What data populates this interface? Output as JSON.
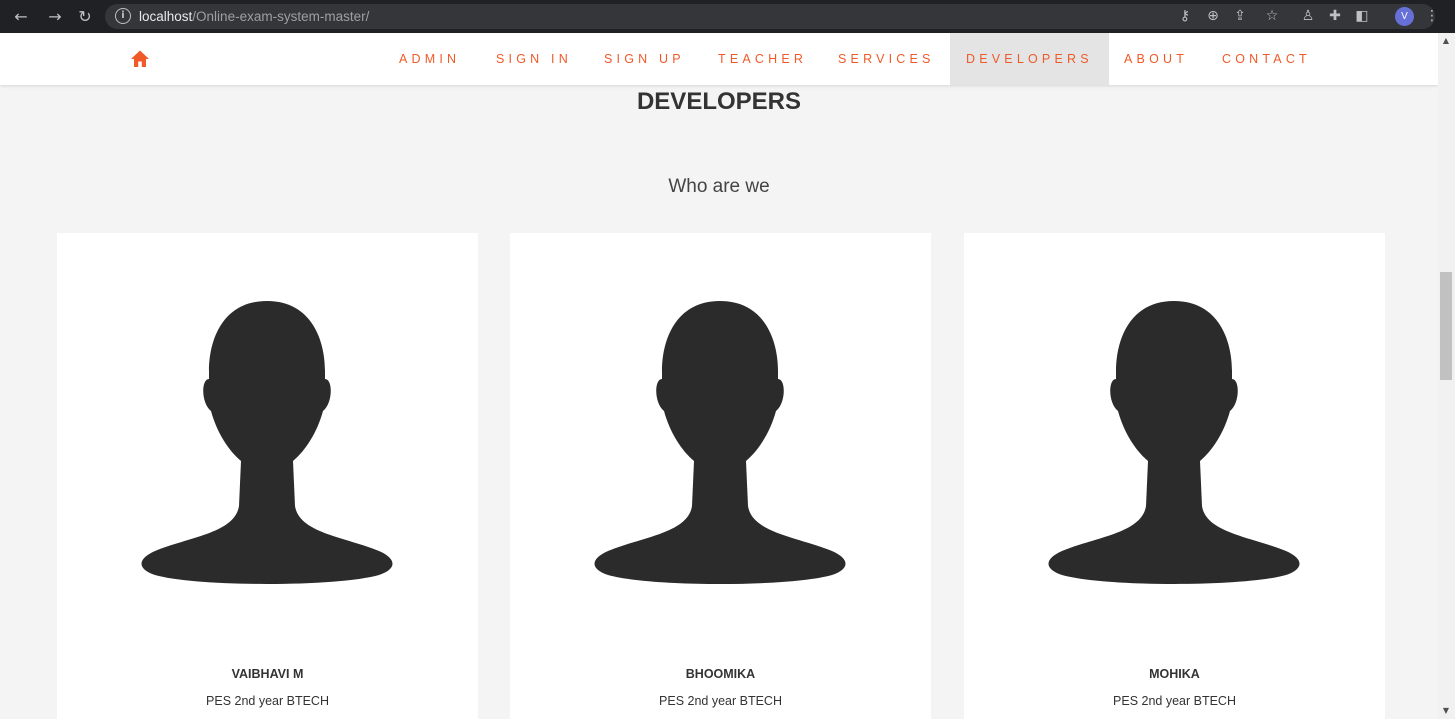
{
  "browser": {
    "url_host": "localhost",
    "url_path": "/Online-exam-system-master/",
    "profile_initial": "V",
    "icons": [
      "back-icon",
      "forward-icon",
      "reload-icon",
      "info-icon",
      "key-icon",
      "zoom-icon",
      "share-icon",
      "star-icon",
      "extension-icon",
      "puzzle-icon",
      "sidepanel-icon",
      "menu-icon"
    ]
  },
  "nav": {
    "home_icon": "home-icon",
    "accent_color": "#f05a28",
    "items": [
      {
        "label": "ADMIN"
      },
      {
        "label": "SIGN IN"
      },
      {
        "label": "SIGN UP"
      },
      {
        "label": "TEACHER"
      },
      {
        "label": "SERVICES"
      },
      {
        "label": "DEVELOPERS",
        "active": true
      },
      {
        "label": "ABOUT"
      },
      {
        "label": "CONTACT"
      }
    ]
  },
  "page": {
    "title": "DEVELOPERS",
    "subtitle": "Who are we"
  },
  "developers": [
    {
      "name": "VAIBHAVI M",
      "role": "PES 2nd year BTECH"
    },
    {
      "name": "BHOOMIKA",
      "role": "PES 2nd year BTECH"
    },
    {
      "name": "MOHIKA",
      "role": "PES 2nd year BTECH"
    }
  ]
}
